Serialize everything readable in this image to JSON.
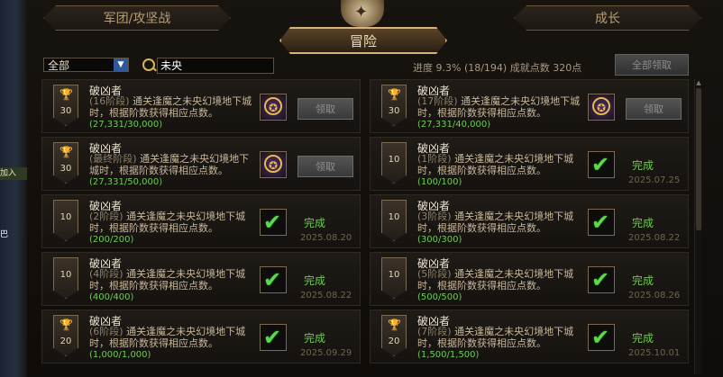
{
  "tabs": {
    "left": "军团/攻坚战",
    "active": "冒险",
    "right": "成长"
  },
  "toolbar": {
    "filter_value": "全部",
    "search_value": "未央",
    "progress_text": "进度  9.3% (18/194)    成就点数 320点",
    "claim_all_label": "全部领取"
  },
  "left_strip": [
    "加入",
    "巴"
  ],
  "cards": [
    {
      "points": "30",
      "title": "破凶者",
      "stage": "(16阶段)",
      "desc": "通关逢魔之未央幻境地下城时，根据阶数获得相应点数。",
      "count": "(27,331/30,000)",
      "status": "claim",
      "claim_label": "领取",
      "done_label": "",
      "date": ""
    },
    {
      "points": "30",
      "title": "破凶者",
      "stage": "(17阶段)",
      "desc": "通关逢魔之未央幻境地下城时，根据阶数获得相应点数。",
      "count": "(27,331/40,000)",
      "status": "claim",
      "claim_label": "领取",
      "done_label": "",
      "date": ""
    },
    {
      "points": "30",
      "title": "破凶者",
      "stage": "(最终阶段)",
      "desc": "通关逢魔之未央幻境地下城时，根据阶数获得相应点数。",
      "count": "(27,331/50,000)",
      "status": "claim",
      "claim_label": "领取",
      "done_label": "",
      "date": ""
    },
    {
      "points": "10",
      "title": "破凶者",
      "stage": "(1阶段)",
      "desc": "通关逢魔之未央幻境地下城时，根据阶数获得相应点数。",
      "count": "(100/100)",
      "status": "done",
      "claim_label": "",
      "done_label": "完成",
      "date": "2025.07.25"
    },
    {
      "points": "10",
      "title": "破凶者",
      "stage": "(2阶段)",
      "desc": "通关逢魔之未央幻境地下城时，根据阶数获得相应点数。",
      "count": "(200/200)",
      "status": "done",
      "claim_label": "",
      "done_label": "完成",
      "date": "2025.08.20"
    },
    {
      "points": "10",
      "title": "破凶者",
      "stage": "(3阶段)",
      "desc": "通关逢魔之未央幻境地下城时，根据阶数获得相应点数。",
      "count": "(300/300)",
      "status": "done",
      "claim_label": "",
      "done_label": "完成",
      "date": "2025.08.22"
    },
    {
      "points": "10",
      "title": "破凶者",
      "stage": "(4阶段)",
      "desc": "通关逢魔之未央幻境地下城时，根据阶数获得相应点数。",
      "count": "(400/400)",
      "status": "done",
      "claim_label": "",
      "done_label": "完成",
      "date": "2025.08.22"
    },
    {
      "points": "10",
      "title": "破凶者",
      "stage": "(5阶段)",
      "desc": "通关逢魔之未央幻境地下城时，根据阶数获得相应点数。",
      "count": "(500/500)",
      "status": "done",
      "claim_label": "",
      "done_label": "完成",
      "date": "2025.08.26"
    },
    {
      "points": "20",
      "title": "破凶者",
      "stage": "(6阶段)",
      "desc": "通关逢魔之未央幻境地下城时，根据阶数获得相应点数。",
      "count": "(1,000/1,000)",
      "status": "done",
      "claim_label": "",
      "done_label": "完成",
      "date": "2025.09.29"
    },
    {
      "points": "20",
      "title": "破凶者",
      "stage": "(7阶段)",
      "desc": "通关逢魔之未央幻境地下城时，根据阶数获得相应点数。",
      "count": "(1,500/1,500)",
      "status": "done",
      "claim_label": "",
      "done_label": "完成",
      "date": "2025.10.01"
    }
  ]
}
